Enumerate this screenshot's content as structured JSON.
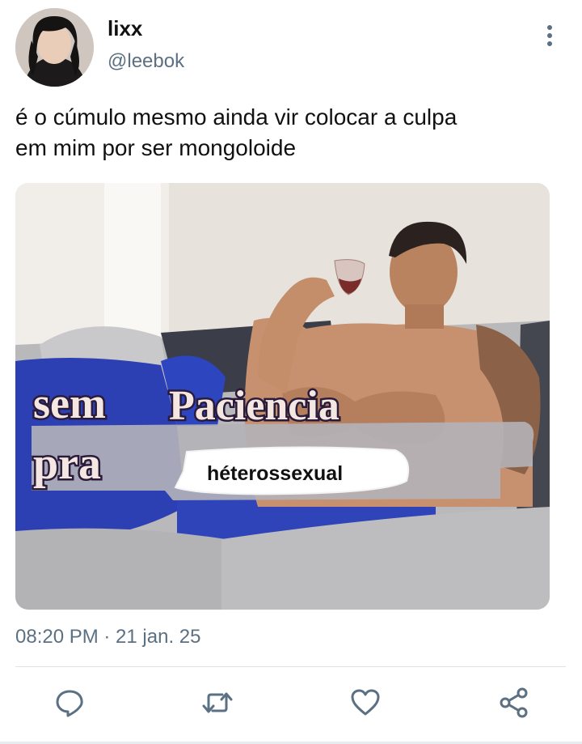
{
  "tweet": {
    "display_name": "lixx",
    "handle": "@leebok",
    "text_line1": "é o cúmulo mesmo ainda vir colocar a culpa",
    "text_line2": "em mim por ser mongoloide",
    "timestamp": "08:20 PM · 21 jan. 25"
  },
  "media": {
    "caption_line1_a": "sem",
    "caption_line1_b": "Paciencia",
    "caption_line2": "pra",
    "sticker_text": "héterossexual"
  },
  "icons": {
    "more": "more-vertical-icon",
    "reply": "reply-icon",
    "retweet": "retweet-icon",
    "like": "heart-icon",
    "share": "share-icon"
  },
  "colors": {
    "handle": "#5b7083",
    "icon": "#5b7083",
    "divider": "#dde3e8"
  }
}
